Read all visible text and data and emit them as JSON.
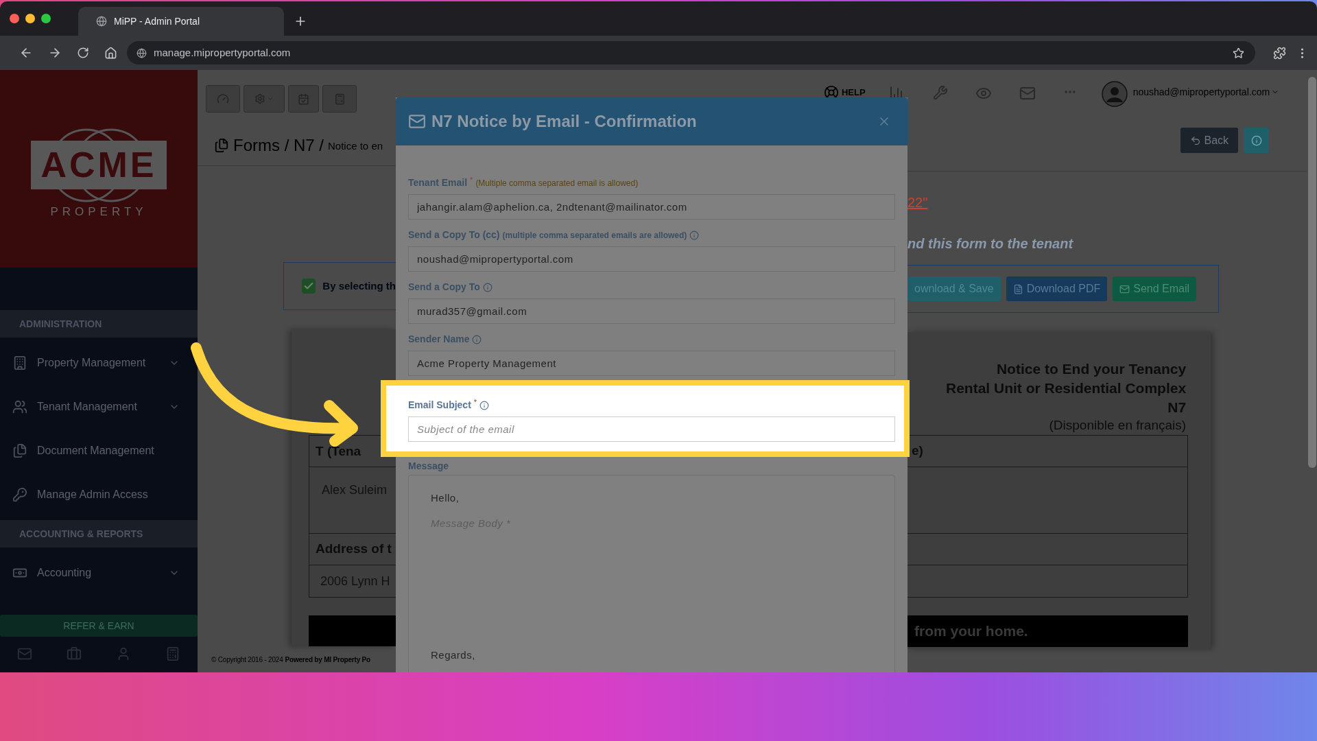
{
  "browser": {
    "tab_title": "MiPP - Admin Portal",
    "url": "manage.mipropertyportal.com"
  },
  "sidebar": {
    "logo_wordmark": "ACME",
    "logo_tagline": "PROPERTY",
    "sections": [
      {
        "heading": "ADMINISTRATION",
        "items": [
          {
            "label": "Property Management",
            "has_submenu": true
          },
          {
            "label": "Tenant Management",
            "has_submenu": true
          },
          {
            "label": "Document Management",
            "has_submenu": false
          },
          {
            "label": "Manage Admin Access",
            "has_submenu": false
          }
        ]
      },
      {
        "heading": "ACCOUNTING & REPORTS",
        "items": [
          {
            "label": "Accounting",
            "has_submenu": true
          }
        ]
      }
    ],
    "refer_button": "REFER & EARN"
  },
  "header": {
    "help_label": "HELP",
    "user_email": "noushad@mipropertyportal.com"
  },
  "page": {
    "breadcrumb": "Forms / N7 /",
    "breadcrumb_current": "Notice to en",
    "back_button": "Back",
    "link_fragment": "22\"",
    "instruction_fragment": "nd this form to the tenant",
    "consent": {
      "checked": true,
      "text": "By selecting th"
    },
    "actions": [
      {
        "label": "ownload & Save",
        "kind": "save"
      },
      {
        "label": "Download PDF",
        "kind": "pdf"
      },
      {
        "label": "Send Email",
        "kind": "email"
      }
    ],
    "document": {
      "title_lines": [
        "Notice to End your Tenancy",
        "Rental Unit or Residential Complex",
        "N7"
      ],
      "subtitle": "(Disponible en français)",
      "left_cells": [
        "T (Tena",
        "Alex Suleim",
        "Address of t",
        "2006 Lynn H"
      ],
      "right_cells": [
        "e)"
      ],
      "banner_fragment": "from your home."
    },
    "footer": {
      "copyright": "© Copyright 2016 - 2024",
      "powered_by": "Powered by MI Property Po"
    }
  },
  "modal": {
    "title": "N7 Notice by Email - Confirmation",
    "fields": [
      {
        "label": "Tenant Email",
        "required_mark": "*",
        "hint": "(Multiple comma separated email is allowed)",
        "info": false,
        "value": "jahangir.alam@aphelion.ca, 2ndtenant@mailinator.com",
        "highlighted": false
      },
      {
        "label": "Send a Copy To (cc)",
        "hint": "(multiple comma separated emails are allowed)",
        "info": true,
        "value": "noushad@mipropertyportal.com",
        "highlighted": false
      },
      {
        "label": "Send a Copy To",
        "info": true,
        "value": "murad357@gmail.com",
        "highlighted": false
      },
      {
        "label": "Sender Name",
        "info": true,
        "value": "Acme Property Management",
        "highlighted": false
      },
      {
        "label": "Email Subject",
        "required_mark": "*",
        "info": true,
        "placeholder": "Subject of the email",
        "highlighted": true
      }
    ],
    "message": {
      "label": "Message",
      "lines": [
        {
          "text": "Hello,",
          "placeholder": false
        },
        {
          "text": "Message Body *",
          "placeholder": true
        },
        {
          "text": "Regards,",
          "placeholder": false
        }
      ]
    }
  }
}
